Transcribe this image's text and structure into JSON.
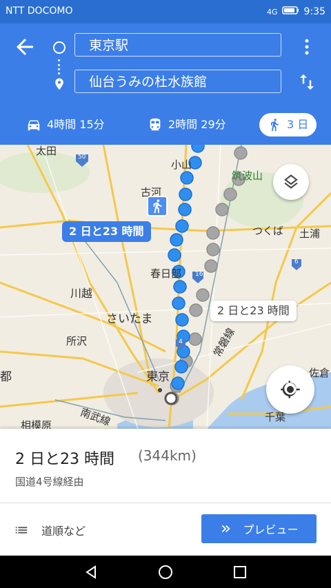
{
  "status_bar": {
    "carrier": "NTT DOCOMO",
    "network": "4G",
    "time": "9:35"
  },
  "header": {
    "back_icon": "arrow-left-icon",
    "origin": "東京駅",
    "destination": "仙台うみの杜水族館",
    "more_icon": "more-vert-icon",
    "swap_icon": "swap-vert-icon",
    "modes": [
      {
        "icon": "car-icon",
        "label": "4時間 15分",
        "active": false
      },
      {
        "icon": "train-icon",
        "label": "2時間 29分",
        "active": false
      },
      {
        "icon": "walk-icon",
        "label": "3 日",
        "active": true
      }
    ]
  },
  "map": {
    "labels": {
      "ota": "太田",
      "oyama": "小山",
      "koga": "古河",
      "tsukubasan": "筑波山",
      "tsukuba": "つくば",
      "tsuchiura": "土浦",
      "kasukabe": "春日部",
      "kawagoe": "川越",
      "saitama": "さいたま",
      "tokorozawa": "所沢",
      "tokyo": "東京",
      "sagamihara": "相模原",
      "chiba": "千葉",
      "to": "都",
      "saki": "佐倉",
      "joban": "常磐線",
      "nambu": "南武線"
    },
    "routes": {
      "primary": "2 日と23 時間",
      "alternate": "2 日と23 時間"
    },
    "shields": [
      "50",
      "4",
      "16",
      "6",
      "4"
    ],
    "layers_icon": "layers-icon",
    "locate_icon": "my-location-icon"
  },
  "summary": {
    "duration": "2 日と23 時間",
    "distance": "(344km)",
    "via": "国道4号線経由",
    "directions_label": "道順など",
    "preview_label": "プレビュー"
  },
  "colors": {
    "header": "#3b7ee8",
    "route": "#2f8ff0",
    "route_alt": "#a6a6a6"
  }
}
